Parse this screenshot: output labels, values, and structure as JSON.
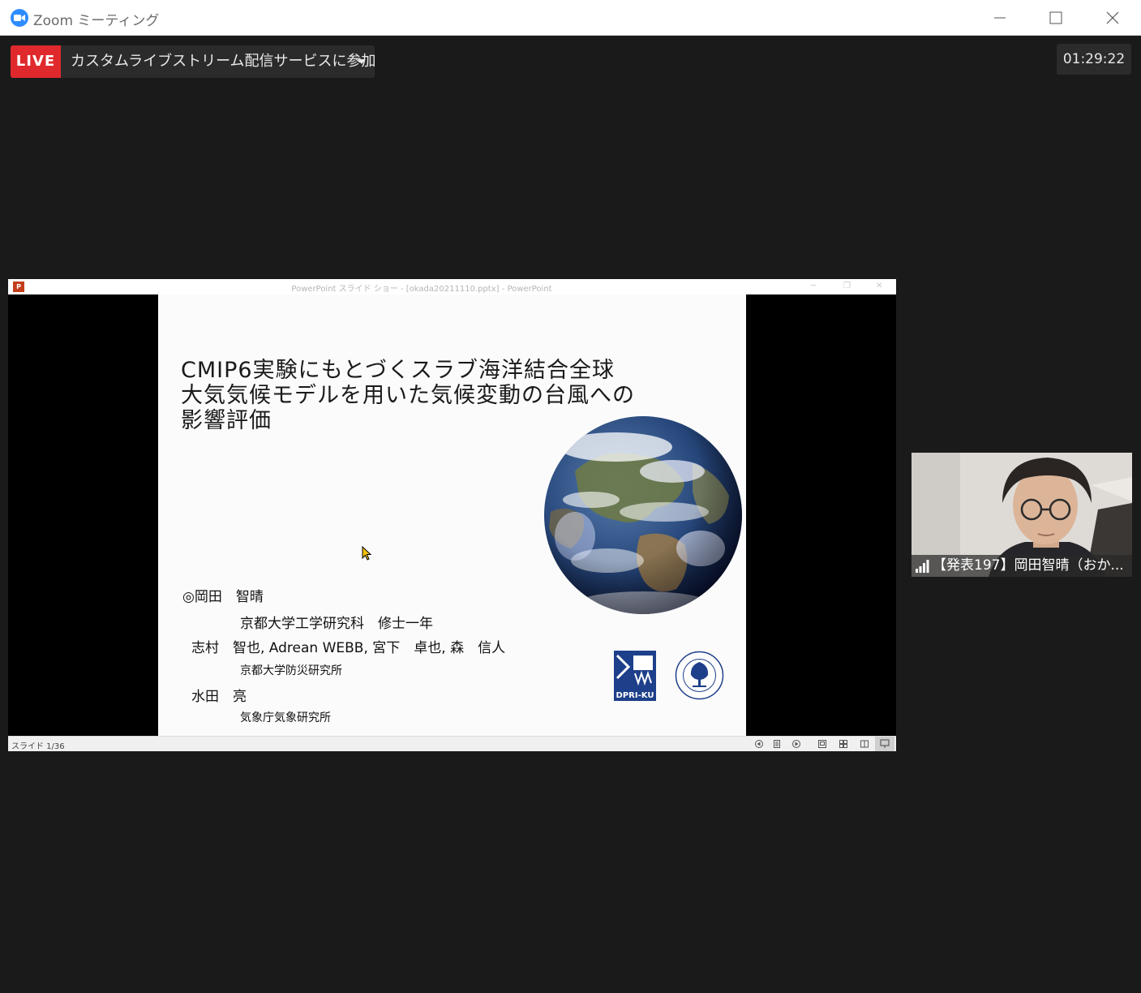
{
  "window": {
    "title": "Zoom ミーティング",
    "icon": "zoom-camera-icon",
    "controls": [
      "minimize-icon",
      "maximize-icon",
      "close-icon"
    ]
  },
  "livestream": {
    "badge": "LIVE",
    "text": "カスタムライブストリーム配信サービスに参加中",
    "badge_color": "#e0292c"
  },
  "timer": "01:29:22",
  "share": {
    "window_title": "PowerPoint スライド ショー - [okada20211110.pptx] - PowerPoint",
    "status": "スライド 1/36",
    "slide": {
      "title_lines": [
        "CMIP6実験にもとづくスラブ海洋結合全球",
        "大気気候モデルを用いた気候変動の台風への",
        "影響評価"
      ],
      "presenter": "◎岡田　智晴",
      "presenter_affiliation": "京都大学工学研究科　修士一年",
      "coauthors": "志村　智也, Adrean WEBB, 宮下　卓也, 森　信人",
      "coauthors_affiliation": "京都大学防災研究所",
      "coauthor2": "水田　亮",
      "coauthor2_affiliation": "気象庁気象研究所",
      "logo_dpri": "DPRI-KU",
      "logo_kyoto": "KYOTO UNIVERSITY"
    }
  },
  "participant": {
    "name": "【発表197】岡田智晴（おか...",
    "signal_icon": "connection-signal-icon"
  },
  "colors": {
    "background": "#1a1a1a",
    "zoom_blue": "#2d8cff",
    "live_red": "#e0292c"
  }
}
